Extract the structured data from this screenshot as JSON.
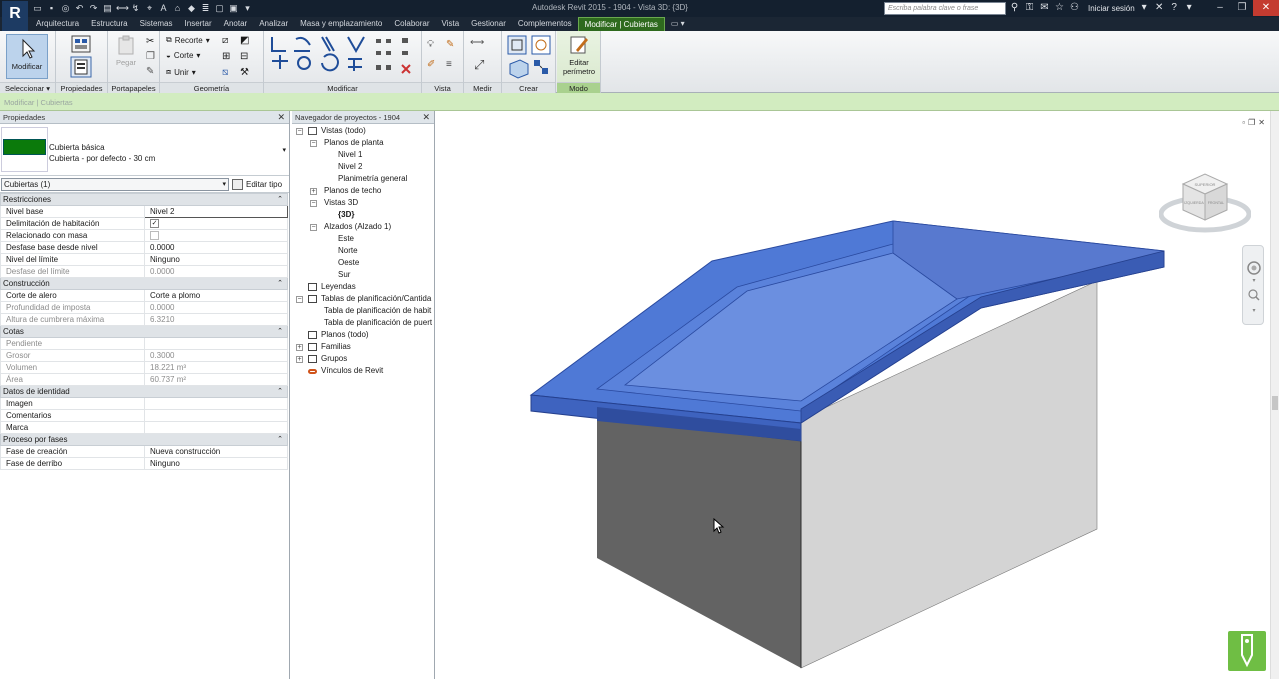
{
  "titlebar": {
    "app_logo": "R",
    "window_title": "Autodesk Revit 2015  -  1904 - Vista 3D: {3D}",
    "search_placeholder": "Escriba palabra clave o frase",
    "signin_label": "Iniciar sesión"
  },
  "tabs": [
    {
      "label": "Arquitectura"
    },
    {
      "label": "Estructura"
    },
    {
      "label": "Sistemas"
    },
    {
      "label": "Insertar"
    },
    {
      "label": "Anotar"
    },
    {
      "label": "Analizar"
    },
    {
      "label": "Masa y emplazamiento"
    },
    {
      "label": "Colaborar"
    },
    {
      "label": "Vista"
    },
    {
      "label": "Gestionar"
    },
    {
      "label": "Complementos"
    },
    {
      "label": "Modificar | Cubiertas"
    }
  ],
  "ribbon": {
    "modify_btn": "Modificar",
    "paste_btn": "Pegar",
    "cut_label": "Recorte",
    "cope_label": "Corte",
    "join_label": "Unir",
    "edit_perimeter": "Editar perímetro",
    "panels": {
      "select": "Seleccionar",
      "properties": "Propiedades",
      "clipboard": "Portapapeles",
      "geometry": "Geometría",
      "modify": "Modificar",
      "view": "Vista",
      "measure": "Medir",
      "create": "Crear",
      "mode": "Modo"
    }
  },
  "context_bar": "Modificar | Cubiertas",
  "properties": {
    "title": "Propiedades",
    "type_family": "Cubierta básica",
    "type_name": "Cubierta - por defecto - 30 cm",
    "filter": "Cubiertas (1)",
    "edit_type": "Editar tipo",
    "groups": [
      {
        "name": "Restricciones",
        "rows": [
          {
            "label": "Nivel base",
            "value": "Nivel 2"
          },
          {
            "label": "Delimitación de habitación",
            "value": "",
            "check": "checked"
          },
          {
            "label": "Relacionado con masa",
            "value": "",
            "check": "grey"
          },
          {
            "label": "Desfase base desde nivel",
            "value": "0.0000"
          },
          {
            "label": "Nivel del límite",
            "value": "Ninguno"
          },
          {
            "label": "Desfase del límite",
            "value": "0.0000",
            "ro": true
          }
        ]
      },
      {
        "name": "Construcción",
        "rows": [
          {
            "label": "Corte de alero",
            "value": "Corte a plomo"
          },
          {
            "label": "Profundidad de imposta",
            "value": "0.0000",
            "ro": true
          },
          {
            "label": "Altura de cumbrera máxima",
            "value": "6.3210",
            "ro": true
          }
        ]
      },
      {
        "name": "Cotas",
        "rows": [
          {
            "label": "Pendiente",
            "value": "",
            "ro": true
          },
          {
            "label": "Grosor",
            "value": "0.3000",
            "ro": true
          },
          {
            "label": "Volumen",
            "value": "18.221 m³",
            "ro": true
          },
          {
            "label": "Área",
            "value": "60.737 m²",
            "ro": true
          }
        ]
      },
      {
        "name": "Datos de identidad",
        "rows": [
          {
            "label": "Imagen",
            "value": ""
          },
          {
            "label": "Comentarios",
            "value": ""
          },
          {
            "label": "Marca",
            "value": ""
          }
        ]
      },
      {
        "name": "Proceso por fases",
        "rows": [
          {
            "label": "Fase de creación",
            "value": "Nueva construcción"
          },
          {
            "label": "Fase de derribo",
            "value": "Ninguno"
          }
        ]
      }
    ]
  },
  "browser": {
    "title": "Navegador de proyectos - 1904",
    "items": [
      {
        "label": "Vistas (todo)",
        "level": 0,
        "toggle": "−",
        "icon": "views"
      },
      {
        "label": "Planos de planta",
        "level": 1,
        "toggle": "−"
      },
      {
        "label": "Nivel 1",
        "level": 2
      },
      {
        "label": "Nivel 2",
        "level": 2
      },
      {
        "label": "Planimetría general",
        "level": 2
      },
      {
        "label": "Planos de techo",
        "level": 1,
        "toggle": "+"
      },
      {
        "label": "Vistas 3D",
        "level": 1,
        "toggle": "−"
      },
      {
        "label": "{3D}",
        "level": 2,
        "bold": true
      },
      {
        "label": "Alzados (Alzado 1)",
        "level": 1,
        "toggle": "−"
      },
      {
        "label": "Este",
        "level": 2
      },
      {
        "label": "Norte",
        "level": 2
      },
      {
        "label": "Oeste",
        "level": 2
      },
      {
        "label": "Sur",
        "level": 2
      },
      {
        "label": "Leyendas",
        "level": 0,
        "icon": "legend"
      },
      {
        "label": "Tablas de planificación/Cantida",
        "level": 0,
        "toggle": "−",
        "icon": "table"
      },
      {
        "label": "Tabla de planificación de habit",
        "level": 1
      },
      {
        "label": "Tabla de planificación de puert",
        "level": 1
      },
      {
        "label": "Planos (todo)",
        "level": 0,
        "icon": "sheet"
      },
      {
        "label": "Familias",
        "level": 0,
        "toggle": "+",
        "icon": "family"
      },
      {
        "label": "Grupos",
        "level": 0,
        "toggle": "+",
        "icon": "group"
      },
      {
        "label": "Vínculos de Revit",
        "level": 0,
        "icon": "link"
      }
    ]
  },
  "viewcube": {
    "top": "SUPERIOR",
    "left": "IZQUIERDA",
    "front": "FRONTAL"
  },
  "colors": {
    "accent_green": "#6aa84f",
    "roof_blue": "#4a76d8",
    "wall_dark": "#606060",
    "wall_light": "#d2d2d2"
  }
}
